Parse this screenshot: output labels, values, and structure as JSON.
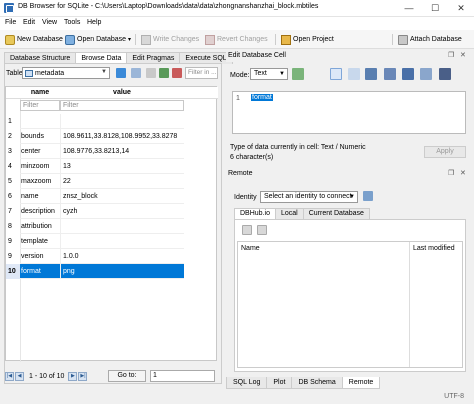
{
  "window": {
    "title": "DB Browser for SQLite - C:\\Users\\Laptop\\Downloads\\data\\data\\zhongnanshanzhai_block.mbtiles",
    "controls": [
      "—",
      "☐",
      "✕"
    ]
  },
  "menu": [
    "File",
    "Edit",
    "View",
    "Tools",
    "Help"
  ],
  "toolbar": {
    "new_database": "New Database",
    "open_database": "Open Database",
    "write_changes": "Write Changes",
    "revert_changes": "Revert Changes",
    "open_project": "Open Project",
    "attach_database": "Attach Database"
  },
  "left_tabs": [
    "Database Structure",
    "Browse Data",
    "Edit Pragmas",
    "Execute SQL"
  ],
  "browse": {
    "table_label": "Table:",
    "table_name": "metadata",
    "filter_placeholder": "Filter in ...",
    "columns": [
      "name",
      "value"
    ],
    "filter_cells": [
      "Filter",
      "Filter"
    ],
    "rows": [
      {
        "n": "1",
        "name": "",
        "value": ""
      },
      {
        "n": "2",
        "name": "bounds",
        "value": "108.9611,33.8128,108.9952,33.8278"
      },
      {
        "n": "3",
        "name": "center",
        "value": "108.9776,33.8213,14"
      },
      {
        "n": "4",
        "name": "minzoom",
        "value": "13"
      },
      {
        "n": "5",
        "name": "maxzoom",
        "value": "22"
      },
      {
        "n": "6",
        "name": "name",
        "value": "znsz_block"
      },
      {
        "n": "7",
        "name": "description",
        "value": "cyzh"
      },
      {
        "n": "8",
        "name": "attribution",
        "value": ""
      },
      {
        "n": "9",
        "name": "template",
        "value": ""
      },
      {
        "n": "9",
        "name": "version",
        "value": "1.0.0"
      },
      {
        "n": "10",
        "name": "format",
        "value": "png"
      }
    ],
    "selected_row": 10,
    "pager_text": "1 - 10 of 10",
    "goto_label": "Go to:",
    "goto_value": "1"
  },
  "edit_cell": {
    "title": "Edit Database Cell",
    "mode_label": "Mode:",
    "mode_value": "Text",
    "line_number": "1",
    "content": "format",
    "type_info_line1": "Type of data currently in cell: Text / Numeric",
    "type_info_line2": "6 character(s)",
    "apply": "Apply"
  },
  "remote": {
    "title": "Remote",
    "identity_label": "Identity",
    "identity_value": "Select an identity to connect",
    "tabs": [
      "DBHub.io",
      "Local",
      "Current Database"
    ],
    "col_name": "Name",
    "col_modified": "Last modified"
  },
  "bottom_tabs": [
    "SQL Log",
    "Plot",
    "DB Schema",
    "Remote"
  ],
  "status": {
    "encoding": "UTF-8"
  },
  "colors": {
    "selection": "#0078d7",
    "accent": "#2f6db5"
  }
}
